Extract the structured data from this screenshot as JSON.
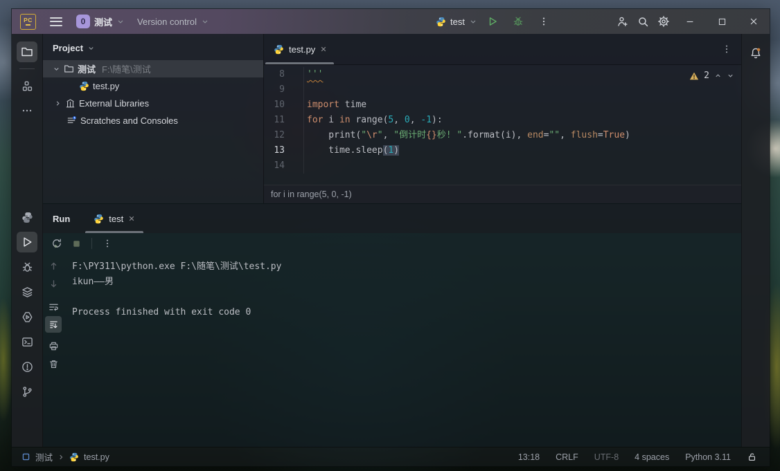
{
  "titlebar": {
    "logo": "PC",
    "project_badge": "0",
    "project_name": "测试",
    "version_control": "Version control",
    "run_config": "test"
  },
  "project_panel": {
    "header": "Project",
    "root_label": "测试",
    "root_path": "F:\\随笔\\测试",
    "file": "test.py",
    "external": "External Libraries",
    "scratches": "Scratches and Consoles"
  },
  "editor": {
    "tab": "test.py",
    "warning_count": "2",
    "context_bar": "for i in range(5, 0, -1)",
    "lines": [
      {
        "num": "8",
        "segments": [
          {
            "t": "'''",
            "c": "str warnline"
          }
        ]
      },
      {
        "num": "9",
        "segments": []
      },
      {
        "num": "10",
        "segments": [
          {
            "t": "import",
            "c": "kw"
          },
          {
            "t": " time",
            "c": "pl"
          }
        ]
      },
      {
        "num": "11",
        "segments": [
          {
            "t": "for",
            "c": "kw"
          },
          {
            "t": " i ",
            "c": "pl"
          },
          {
            "t": "in",
            "c": "kw"
          },
          {
            "t": " range(",
            "c": "pl"
          },
          {
            "t": "5",
            "c": "num"
          },
          {
            "t": ", ",
            "c": "pl"
          },
          {
            "t": "0",
            "c": "num"
          },
          {
            "t": ", ",
            "c": "pl"
          },
          {
            "t": "-1",
            "c": "num"
          },
          {
            "t": "):",
            "c": "pl"
          }
        ]
      },
      {
        "num": "12",
        "segments": [
          {
            "t": "    print(",
            "c": "pl"
          },
          {
            "t": "\"",
            "c": "str"
          },
          {
            "t": "\\r",
            "c": "esc"
          },
          {
            "t": "\"",
            "c": "str"
          },
          {
            "t": ", ",
            "c": "pl"
          },
          {
            "t": "\"倒计时",
            "c": "str"
          },
          {
            "t": "{}",
            "c": "esc"
          },
          {
            "t": "秒! \"",
            "c": "str"
          },
          {
            "t": ".format(i), ",
            "c": "pl"
          },
          {
            "t": "end",
            "c": "prm"
          },
          {
            "t": "=",
            "c": "pl"
          },
          {
            "t": "\"\"",
            "c": "str"
          },
          {
            "t": ", ",
            "c": "pl"
          },
          {
            "t": "flush",
            "c": "prm"
          },
          {
            "t": "=",
            "c": "pl"
          },
          {
            "t": "True",
            "c": "kw"
          },
          {
            "t": ")",
            "c": "pl"
          }
        ]
      },
      {
        "num": "13",
        "current": true,
        "segments": [
          {
            "t": "    time.sleep",
            "c": "pl"
          },
          {
            "t": "(",
            "c": "pl brace"
          },
          {
            "t": "1",
            "c": "num brace"
          },
          {
            "t": ")",
            "c": "pl brace"
          }
        ]
      },
      {
        "num": "14",
        "segments": []
      }
    ]
  },
  "run_panel": {
    "title": "Run",
    "tab": "test",
    "console": [
      "F:\\PY311\\python.exe F:\\随笔\\测试\\test.py",
      "ikun——男",
      "",
      "Process finished with exit code 0"
    ]
  },
  "statusbar": {
    "project": "测试",
    "file": "test.py",
    "items": [
      {
        "text": "13:18"
      },
      {
        "text": "CRLF"
      },
      {
        "text": "UTF-8",
        "dim": true
      },
      {
        "text": "4 spaces"
      },
      {
        "text": "Python 3.11"
      }
    ]
  },
  "colors": {
    "accent_warning": "#d6ae5c",
    "run_green": "#5fad65",
    "badge_purple": "#a796da",
    "keyword": "#cf8e6d",
    "string": "#6aab73",
    "number": "#2aacb8"
  }
}
